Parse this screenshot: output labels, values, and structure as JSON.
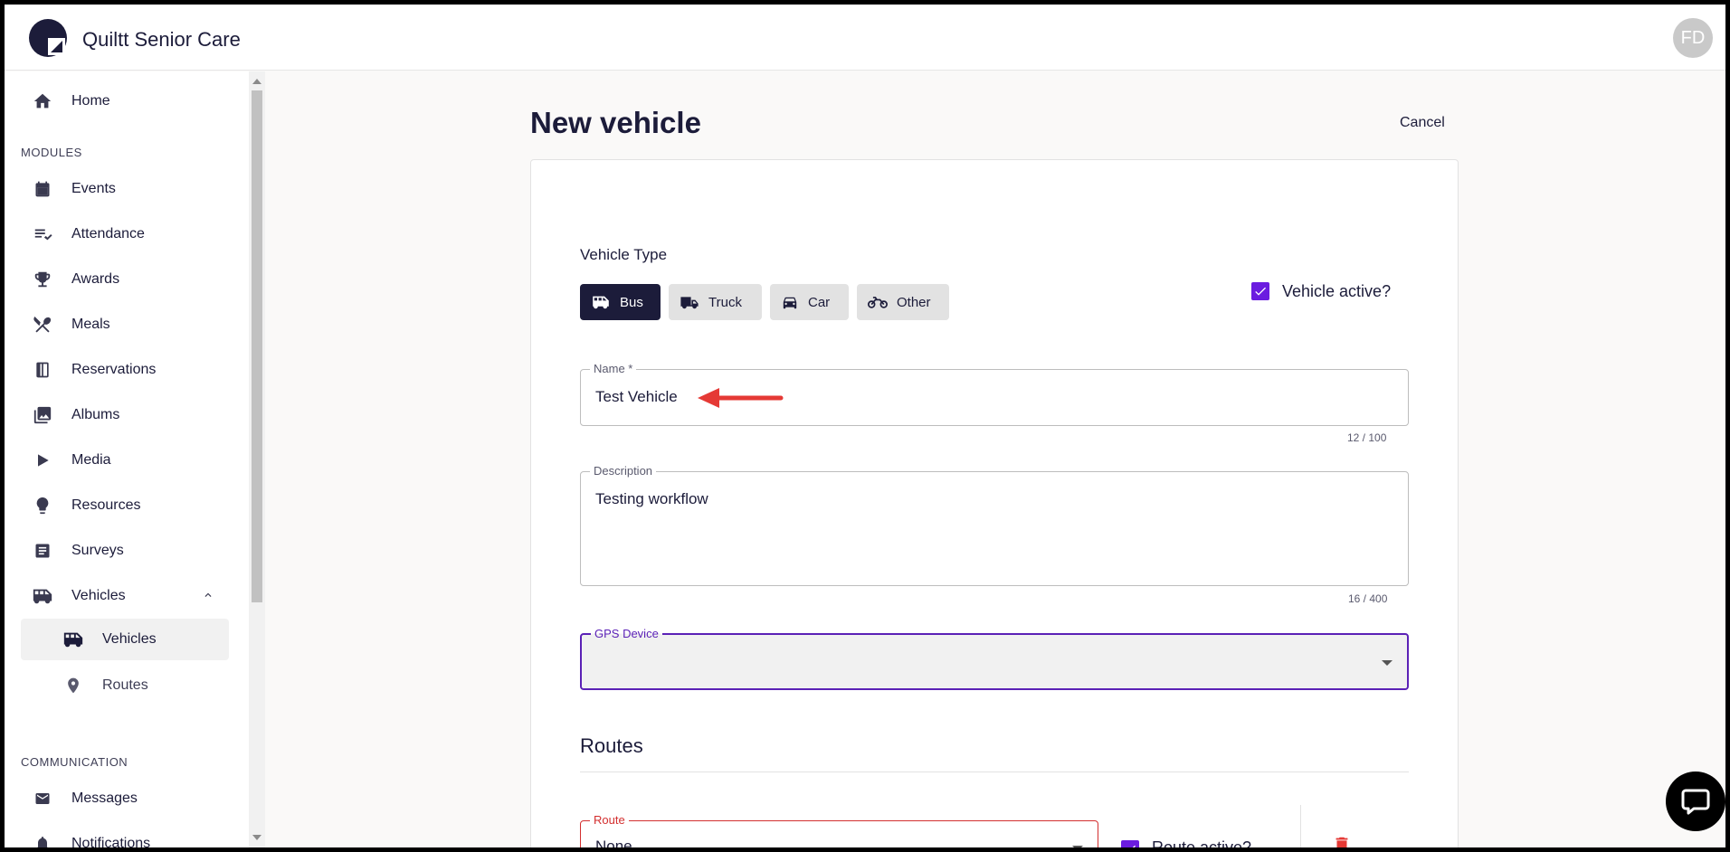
{
  "app": {
    "title": "Quiltt Senior Care",
    "avatar_initials": "FD"
  },
  "sidebar": {
    "home": "Home",
    "modules_label": "MODULES",
    "items": [
      {
        "label": "Events",
        "icon": "calendar-icon"
      },
      {
        "label": "Attendance",
        "icon": "checklist-icon"
      },
      {
        "label": "Awards",
        "icon": "trophy-icon"
      },
      {
        "label": "Meals",
        "icon": "utensils-icon"
      },
      {
        "label": "Reservations",
        "icon": "book-icon"
      },
      {
        "label": "Albums",
        "icon": "photo-library-icon"
      },
      {
        "label": "Media",
        "icon": "play-icon"
      },
      {
        "label": "Resources",
        "icon": "lightbulb-icon"
      },
      {
        "label": "Surveys",
        "icon": "survey-icon"
      },
      {
        "label": "Vehicles",
        "icon": "bus-icon"
      }
    ],
    "sub_items": [
      {
        "label": "Vehicles",
        "icon": "bus-icon"
      },
      {
        "label": "Routes",
        "icon": "location-pin-icon"
      }
    ],
    "communication_label": "COMMUNICATION",
    "comm_items": [
      {
        "label": "Messages",
        "icon": "envelope-icon"
      },
      {
        "label": "Notifications",
        "icon": "bell-icon"
      }
    ]
  },
  "main": {
    "title": "New vehicle",
    "cancel_label": "Cancel",
    "vehicle_type_label": "Vehicle Type",
    "types": [
      "Bus",
      "Truck",
      "Car",
      "Other"
    ],
    "selected_type": "Bus",
    "active_label": "Vehicle active?",
    "name": {
      "label": "Name *",
      "value": "Test Vehicle",
      "counter": "12 / 100"
    },
    "description": {
      "label": "Description",
      "value": "Testing workflow",
      "counter": "16 / 400"
    },
    "gps": {
      "label": "GPS Device",
      "value": ""
    },
    "routes_title": "Routes",
    "route": {
      "label": "Route",
      "value": "None",
      "active_label": "Route active?"
    }
  },
  "colors": {
    "primary": "#1c1c3a",
    "accent": "#6b1ce0",
    "error": "#d32f2f",
    "annotation": "#e53935"
  }
}
